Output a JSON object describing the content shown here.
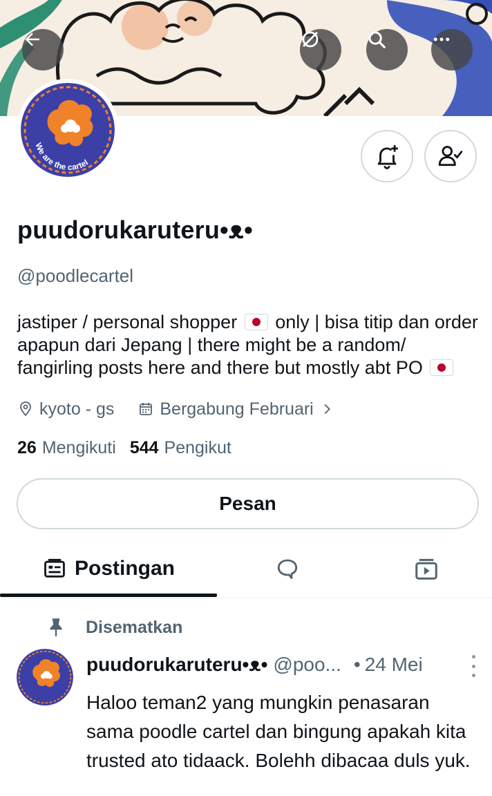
{
  "header": {
    "back_icon": "arrow-left-icon",
    "grok_icon": "grok-icon",
    "search_icon": "search-icon",
    "more_icon": "more-horizontal-icon"
  },
  "profile": {
    "display_name": "puudorukaruteru•ᴥ•",
    "handle": "@poodlecartel",
    "avatar_text": "We are the cartel",
    "bio": {
      "part1": "jastiper / personal shopper",
      "part2": "only | bisa titip dan order apapun dari Jepang | there might be a random/ fangirling posts here and there but mostly abt PO"
    },
    "location": "kyoto - gs",
    "joined": "Bergabung Februari",
    "following_count": "26",
    "following_label": "Mengikuti",
    "followers_count": "544",
    "followers_label": "Pengikut",
    "message_button": "Pesan"
  },
  "tabs": [
    {
      "label": "Postingan",
      "icon": "posts-icon",
      "active": true
    },
    {
      "label": "",
      "icon": "replies-icon",
      "active": false
    },
    {
      "label": "",
      "icon": "media-icon",
      "active": false
    }
  ],
  "pinned": {
    "label": "Disematkan",
    "post": {
      "author": "puudorukaruteru•ᴥ•",
      "handle": "@poo...",
      "separator": "•",
      "date": "24 Mei",
      "text": "Haloo teman2 yang mungkin penasaran sama poodle cartel dan bingung apakah kita trusted ato tidaack. Bolehh dibacaa duls yuk."
    }
  },
  "colors": {
    "avatar_bg": "#3b3fa6",
    "avatar_orange": "#f0822a",
    "text_secondary": "#536471",
    "border": "#cfd9de"
  }
}
